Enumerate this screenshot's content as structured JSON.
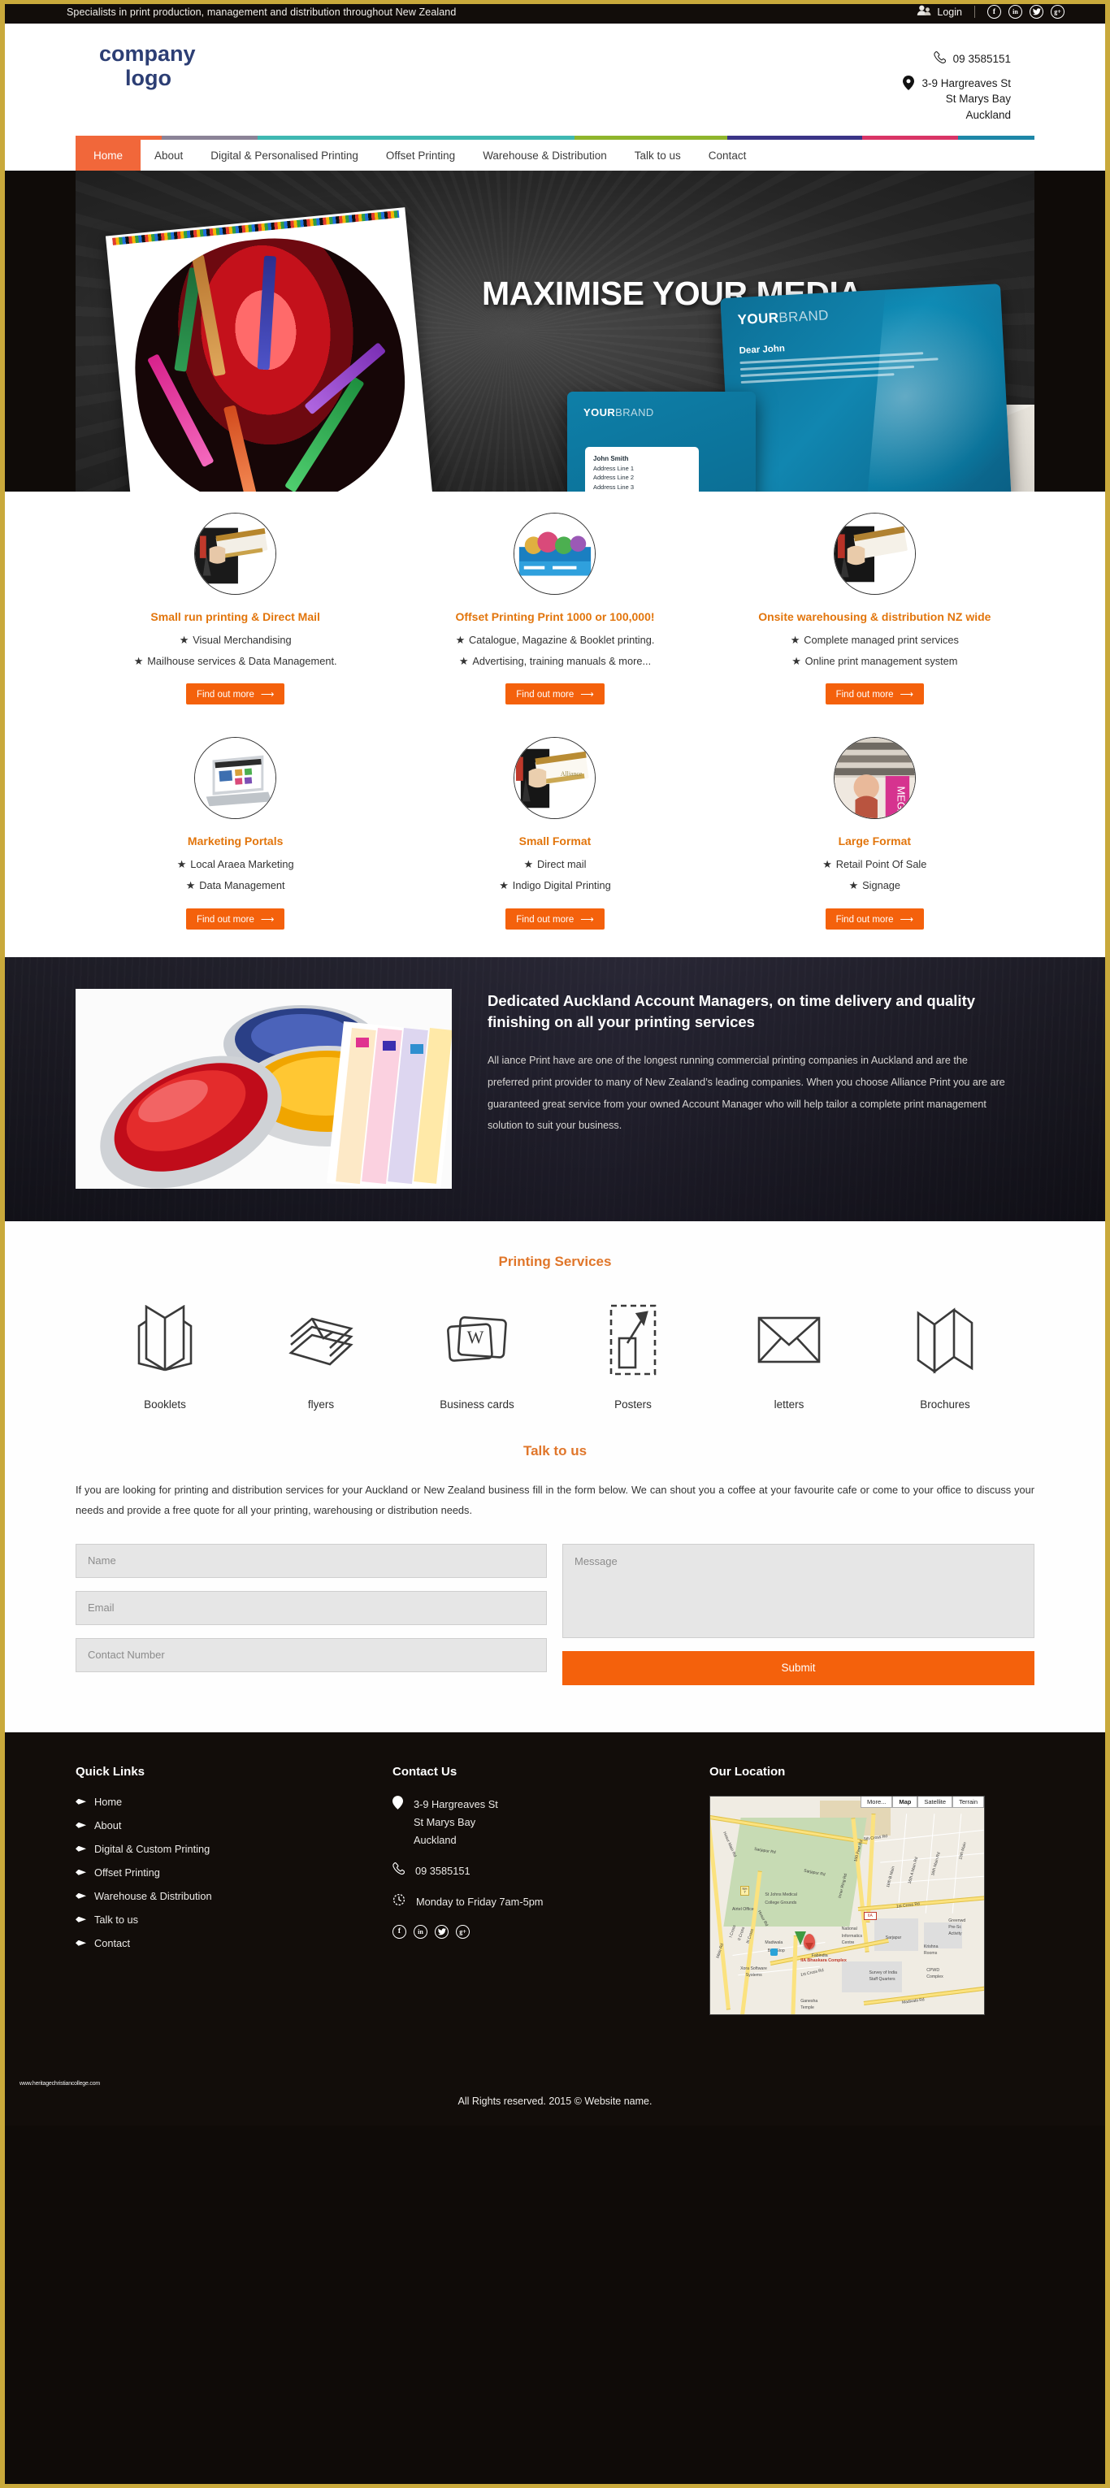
{
  "theme": {
    "accent_orange": "#f4610c",
    "heading_orange": "#e0762a",
    "nav_active": "#f1673a",
    "gold_frame": "#c9a93b",
    "dark_bg": "#120d0a",
    "logo_blue": "#2c3e74"
  },
  "topbar": {
    "tagline": "Specialists in print production, management and distribution throughout New Zealand",
    "login_label": "Login",
    "socials": [
      "f",
      "in",
      "t",
      "g+"
    ]
  },
  "header": {
    "logo_line1": "company",
    "logo_line2": "logo",
    "phone": "09 3585151",
    "address_line1": "3-9 Hargreaves St",
    "address_line2": "St Marys Bay",
    "address_line3": "Auckland"
  },
  "nav": {
    "items": [
      {
        "label": "Home",
        "active": true
      },
      {
        "label": "About",
        "active": false
      },
      {
        "label": "Digital & Personalised Printing",
        "active": false
      },
      {
        "label": "Offset Printing",
        "active": false
      },
      {
        "label": "Warehouse & Distribution",
        "active": false
      },
      {
        "label": "Talk to us",
        "active": false
      },
      {
        "label": "Contact",
        "active": false
      }
    ],
    "stripe_colors": [
      "#f1673a",
      "#8b8397",
      "#3fb8b2",
      "#8fb52c",
      "#3a3487",
      "#d93466",
      "#1e87a8"
    ]
  },
  "hero": {
    "title": "MAXIMISE YOUR MEDIA",
    "card_brand_bold": "YOUR",
    "card_brand_light": "BRAND",
    "letter_salutation": "Dear John",
    "address_name": "John Smith",
    "address_l1": "Address Line 1",
    "address_l2": "Address Line 2",
    "address_l3": "Address Line 3"
  },
  "services": {
    "row1": [
      {
        "title": "Small run printing & Direct Mail",
        "bullets": [
          "Visual Merchandising",
          "Mailhouse services & Data Management."
        ],
        "button": "Find out more",
        "icon": "direct-mail-photo"
      },
      {
        "title": "Offset Printing Print 1000 or 100,000!",
        "bullets": [
          "Catalogue, Magazine & Booklet printing.",
          "Advertising, training manuals & more..."
        ],
        "button": "Find out more",
        "icon": "offset-catalogue-photo"
      },
      {
        "title": "Onsite warehousing & distribution NZ wide",
        "bullets": [
          "Complete managed print services",
          "Online print management system"
        ],
        "button": "Find out more",
        "icon": "warehouse-photo"
      }
    ],
    "row2": [
      {
        "title": "Marketing Portals",
        "bullets": [
          "Local Araea Marketing",
          "Data Management"
        ],
        "button": "Find out more",
        "icon": "laptop-photo"
      },
      {
        "title": "Small Format",
        "bullets": [
          "Direct mail",
          "Indigo Digital Printing"
        ],
        "button": "Find out more",
        "icon": "small-format-photo"
      },
      {
        "title": "Large Format",
        "bullets": [
          "Retail Point Of Sale",
          "Signage"
        ],
        "button": "Find out more",
        "icon": "large-format-photo"
      }
    ]
  },
  "feature": {
    "heading": "Dedicated Auckland Account Managers, on time delivery and quality finishing on all your printing services",
    "body": "All iance Print have are one of the longest running commercial printing companies in Auckland and are the preferred print provider to many of New Zealand’s leading companies. When you choose Alliance Print you are are guaranteed great service from your owned Account Manager who will help tailor a complete print management solution to suit your business.",
    "image_alt": "paint-tins-and-colour-swatches"
  },
  "printing_services": {
    "title": "Printing Services",
    "items": [
      {
        "label": "Booklets",
        "icon": "booklet-icon"
      },
      {
        "label": "flyers",
        "icon": "flyers-icon"
      },
      {
        "label": "Business cards",
        "icon": "business-card-icon"
      },
      {
        "label": "Posters",
        "icon": "poster-icon"
      },
      {
        "label": "letters",
        "icon": "envelope-icon"
      },
      {
        "label": "Brochures",
        "icon": "brochure-icon"
      }
    ]
  },
  "talk": {
    "title": "Talk to us",
    "body": "If you are looking for printing and distribution services for your Auckland or New Zealand business fill in the form below. We can shout you a coffee at your favourite cafe or come to your office to discuss your needs and provide a free quote for all your printing, warehousing or distribution needs.",
    "form": {
      "name_placeholder": "Name",
      "email_placeholder": "Email",
      "contact_placeholder": "Contact Number",
      "message_placeholder": "Message",
      "submit_label": "Submit"
    }
  },
  "footer": {
    "quick_links_title": "Quick Links",
    "quick_links": [
      "Home",
      "About",
      "Digital & Custom Printing",
      "Offset Printing",
      "Warehouse & Distribution",
      "Talk to us",
      "Contact"
    ],
    "contact_title": "Contact Us",
    "address_l1": "3-9 Hargreaves St",
    "address_l2": "St Marys Bay",
    "address_l3": "Auckland",
    "phone": "09 3585151",
    "hours": "Monday to Friday 7am-5pm",
    "socials": [
      "f",
      "in",
      "t",
      "g+"
    ],
    "location_title": "Our Location",
    "map": {
      "controls": [
        "More...",
        "Map",
        "Satellite",
        "Terrain"
      ],
      "active_control": "Map",
      "labels": [
        "Hosur Main Rd",
        "Sarjapur Rd",
        "Sarjapur Rd",
        "100 Feet Rd",
        "Inner Ring Rd",
        "5th Cross Rd",
        "1st Cross Rd",
        "16th B Main",
        "16th A Main Rd",
        "16th Main Rd",
        "15th Main",
        "Hosur Rd",
        "1st Cross Rd",
        "Madivala Rd",
        "I Cross",
        "II Cross",
        "III Cross",
        "Main Rd",
        "St Johns Medical",
        "College Grounds",
        "Airtel Office",
        "Madiwala",
        "Bus Stop",
        "Xora Software",
        "Systems",
        "National",
        "Informatics",
        "Centre",
        "Fabindia",
        "Sarjapur",
        "Krishna",
        "Rooms",
        "Survey of India",
        "Staff Quarters",
        "CPWD",
        "Complex",
        "Greenwd",
        "Pre-Sc",
        "Activity",
        "Ganesha",
        "Temple",
        "IIA"
      ],
      "marker_label": "IIA Bhaskara Complex"
    },
    "watermark": "www.heritagechristiancollege.com",
    "copyright": "All Rights reserved. 2015 © Website name."
  }
}
